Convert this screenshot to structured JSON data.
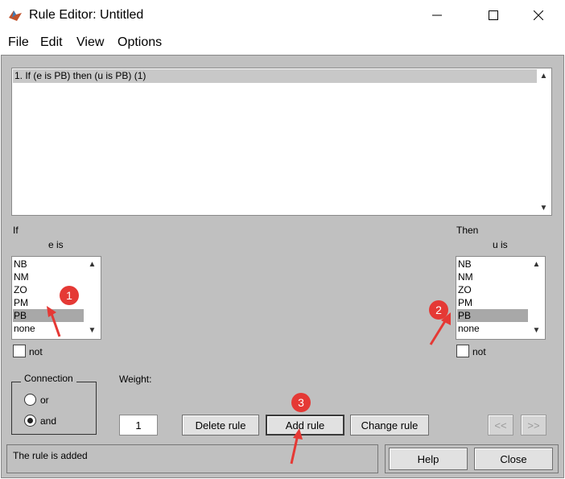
{
  "window": {
    "title": "Rule Editor: Untitled"
  },
  "menu": {
    "items": [
      "File",
      "Edit",
      "View",
      "Options"
    ]
  },
  "rules": {
    "items": [
      "1. If (e is PB) then (u is PB) (1)"
    ]
  },
  "if_panel": {
    "label": "If",
    "variable_label": "e is",
    "options": [
      "NB",
      "NM",
      "ZO",
      "PM",
      "PB",
      "none"
    ],
    "selected": "PB",
    "not_label": "not"
  },
  "then_panel": {
    "label": "Then",
    "variable_label": "u is",
    "options": [
      "NB",
      "NM",
      "ZO",
      "PM",
      "PB",
      "none"
    ],
    "selected": "PB",
    "not_label": "not"
  },
  "connection": {
    "label": "Connection",
    "or_label": "or",
    "and_label": "and",
    "selected": "and"
  },
  "weight": {
    "label": "Weight:",
    "value": "1"
  },
  "buttons": {
    "delete": "Delete rule",
    "add": "Add rule",
    "change": "Change rule",
    "prev": "<<",
    "next": ">>",
    "help": "Help",
    "close": "Close"
  },
  "status": {
    "text": "The rule is added"
  },
  "annotations": [
    "1",
    "2",
    "3"
  ],
  "colors": {
    "annotation": "#e53935",
    "selection": "#a8a8a8",
    "panel": "#c0c0c0"
  }
}
